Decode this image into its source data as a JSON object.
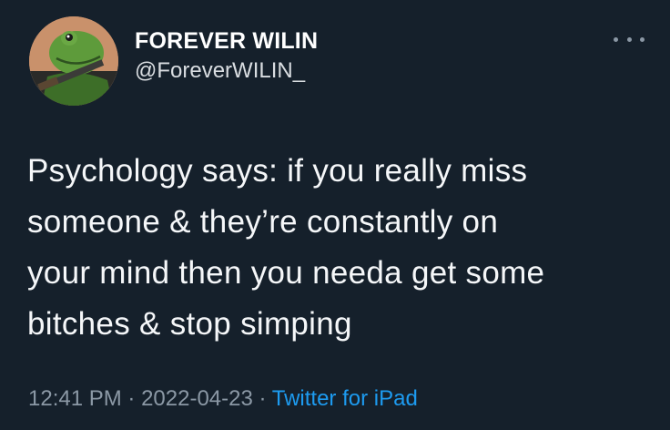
{
  "user": {
    "display_name": "FOREVER WILIN",
    "handle": "@ForeverWILIN_",
    "avatar_icon": "frog-with-rifle-avatar"
  },
  "menu": {
    "icon": "more-options-icon"
  },
  "tweet": {
    "lines": [
      "Psychology says: if you really miss",
      "someone & they’re constantly on",
      "your mind then you needa get some",
      "bitches & stop simping"
    ]
  },
  "meta": {
    "time": "12:41 PM",
    "separator": "·",
    "date": "2022-04-23",
    "source": "Twitter for iPad"
  },
  "colors": {
    "background": "#15202b",
    "secondary_text": "#8b98a5",
    "link": "#1d9bf0"
  }
}
